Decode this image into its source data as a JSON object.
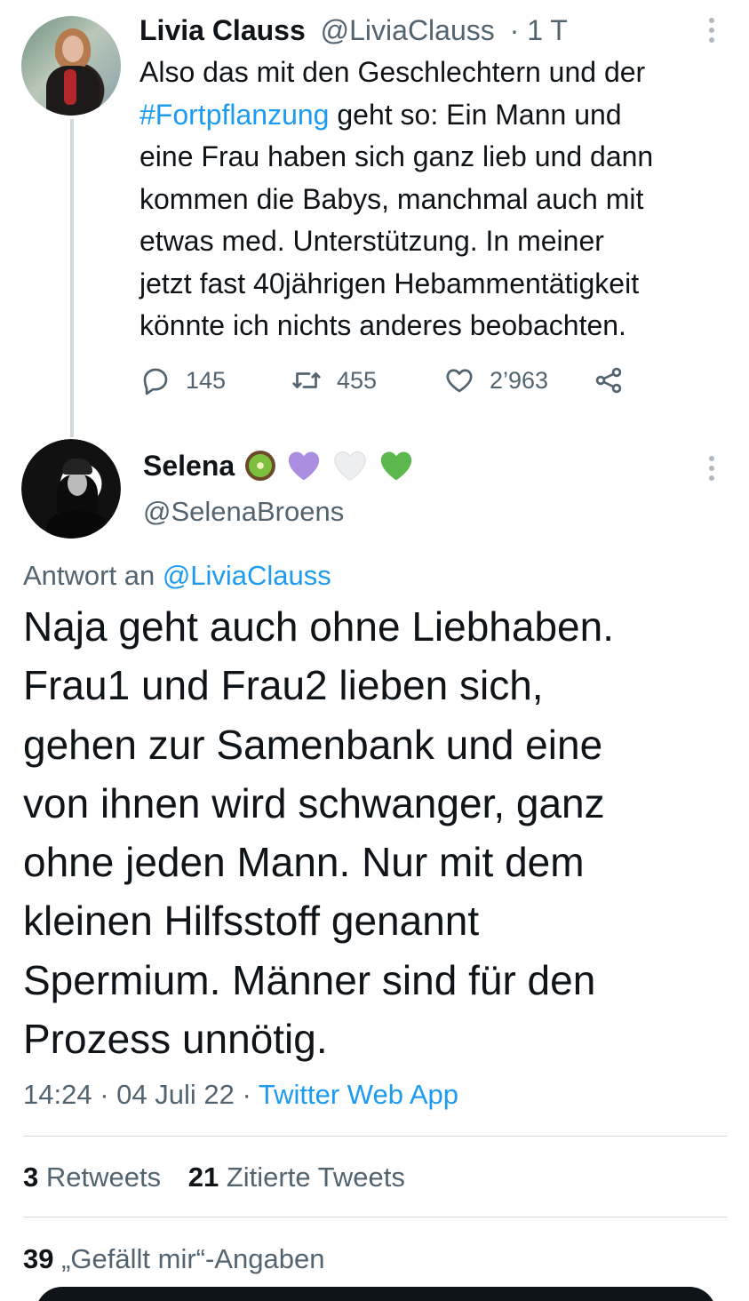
{
  "parent_tweet": {
    "author_name": "Livia Clauss",
    "author_handle": "@LiviaClauss",
    "time_ago": "· 1 T",
    "text_lines": [
      [
        "Also das mit den Geschlechtern und der",
        ""
      ],
      [
        "",
        "#Fortpflanzung",
        " geht so: Ein Mann und"
      ],
      [
        "eine Frau haben sich ganz lieb und dann"
      ],
      [
        "kommen die Babys, manchmal auch mit"
      ],
      [
        "etwas med. Unterstützung. In meiner"
      ],
      [
        "jetzt fast 40jährigen Hebammentätigkeit"
      ],
      [
        "könnte ich nichts anderes beobachten."
      ]
    ],
    "line1": "Also das mit den Geschlechtern und der",
    "hashtag": "#Fortpflanzung",
    "line2_rest": " geht so: Ein Mann und",
    "line3": "eine Frau haben sich ganz lieb und dann",
    "line4": "kommen die Babys, manchmal auch mit",
    "line5": "etwas med. Unterstützung. In meiner",
    "line6": "jetzt fast 40jährigen Hebammentätigkeit",
    "line7": "könnte ich nichts anderes beobachten.",
    "replies": "145",
    "retweets": "455",
    "likes": "2’963"
  },
  "reply_tweet": {
    "author_name": "Selena",
    "author_handle": "@SelenaBroens",
    "emoji_icons": [
      "kiwi-icon",
      "purple-heart-icon",
      "white-heart-icon",
      "green-heart-icon"
    ],
    "reply_to_prefix": "Antwort an ",
    "reply_to_handle": "@LiviaClauss",
    "body_lines": {
      "l1": "Naja geht auch ohne Liebhaben.",
      "l2": "Frau1 und Frau2 lieben sich,",
      "l3": "gehen zur Samenbank und eine",
      "l4": "von ihnen wird schwanger, ganz",
      "l5": "ohne jeden Mann. Nur mit dem",
      "l6": "kleinen Hilfsstoff genannt",
      "l7": "Spermium. Männer sind für den",
      "l8": "Prozess unnötig."
    },
    "time": "14:24",
    "date": "04 Juli 22",
    "separator": " · ",
    "source_app": "Twitter Web App",
    "retweets_count": "3",
    "retweets_label": " Retweets",
    "quotes_count": "21",
    "quotes_label": " Zitierte Tweets",
    "likes_count": "39",
    "likes_label": " „Gefällt mir“-Angaben"
  },
  "colors": {
    "link": "#1d9bf0",
    "secondary_text": "#536471",
    "primary_text": "#0f1419",
    "divider": "#cfd9de"
  }
}
